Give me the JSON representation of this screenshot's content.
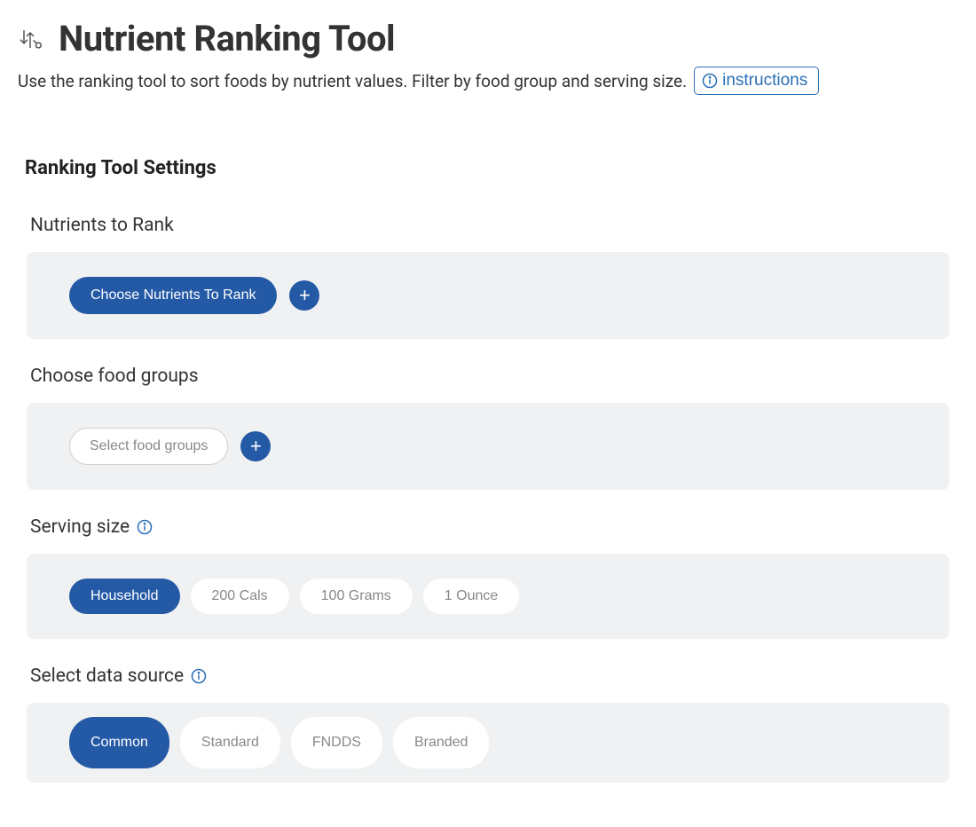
{
  "header": {
    "title": "Nutrient Ranking Tool",
    "subtitle": "Use the ranking tool to sort foods by nutrient values. Filter by food group and serving size.",
    "instructions_label": "instructions"
  },
  "settings": {
    "heading": "Ranking Tool Settings",
    "nutrients": {
      "label": "Nutrients to Rank",
      "choose_button": "Choose Nutrients To Rank"
    },
    "food_groups": {
      "label": "Choose food groups",
      "select_button": "Select food groups"
    },
    "serving_size": {
      "label": "Serving size",
      "options": [
        "Household",
        "200 Cals",
        "100 Grams",
        "1 Ounce"
      ],
      "selected_index": 0
    },
    "data_source": {
      "label": "Select data source",
      "options": [
        "Common",
        "Standard",
        "FNDDS",
        "Branded"
      ],
      "selected_index": 0
    }
  }
}
